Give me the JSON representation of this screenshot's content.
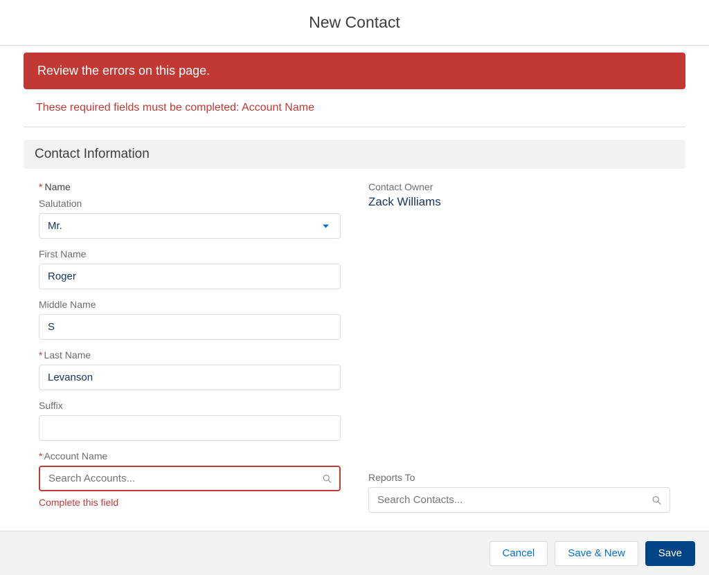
{
  "header": {
    "title": "New Contact"
  },
  "errors": {
    "banner": "Review the errors on this page.",
    "detail": "These required fields must be completed: Account Name"
  },
  "section": {
    "title": "Contact Information"
  },
  "fields": {
    "name_group_label": "Name",
    "salutation": {
      "label": "Salutation",
      "value": "Mr."
    },
    "first_name": {
      "label": "First Name",
      "value": "Roger"
    },
    "middle_name": {
      "label": "Middle Name",
      "value": "S"
    },
    "last_name": {
      "label": "Last Name",
      "value": "Levanson"
    },
    "suffix": {
      "label": "Suffix",
      "value": ""
    },
    "account_name": {
      "label": "Account Name",
      "placeholder": "Search Accounts...",
      "field_error": "Complete this field"
    },
    "contact_owner": {
      "label": "Contact Owner",
      "value": "Zack Williams"
    },
    "reports_to": {
      "label": "Reports To",
      "placeholder": "Search Contacts..."
    }
  },
  "footer": {
    "cancel": "Cancel",
    "save_new": "Save & New",
    "save": "Save"
  },
  "colors": {
    "error": "#c23934",
    "brand": "#014486",
    "link": "#0070d2"
  }
}
